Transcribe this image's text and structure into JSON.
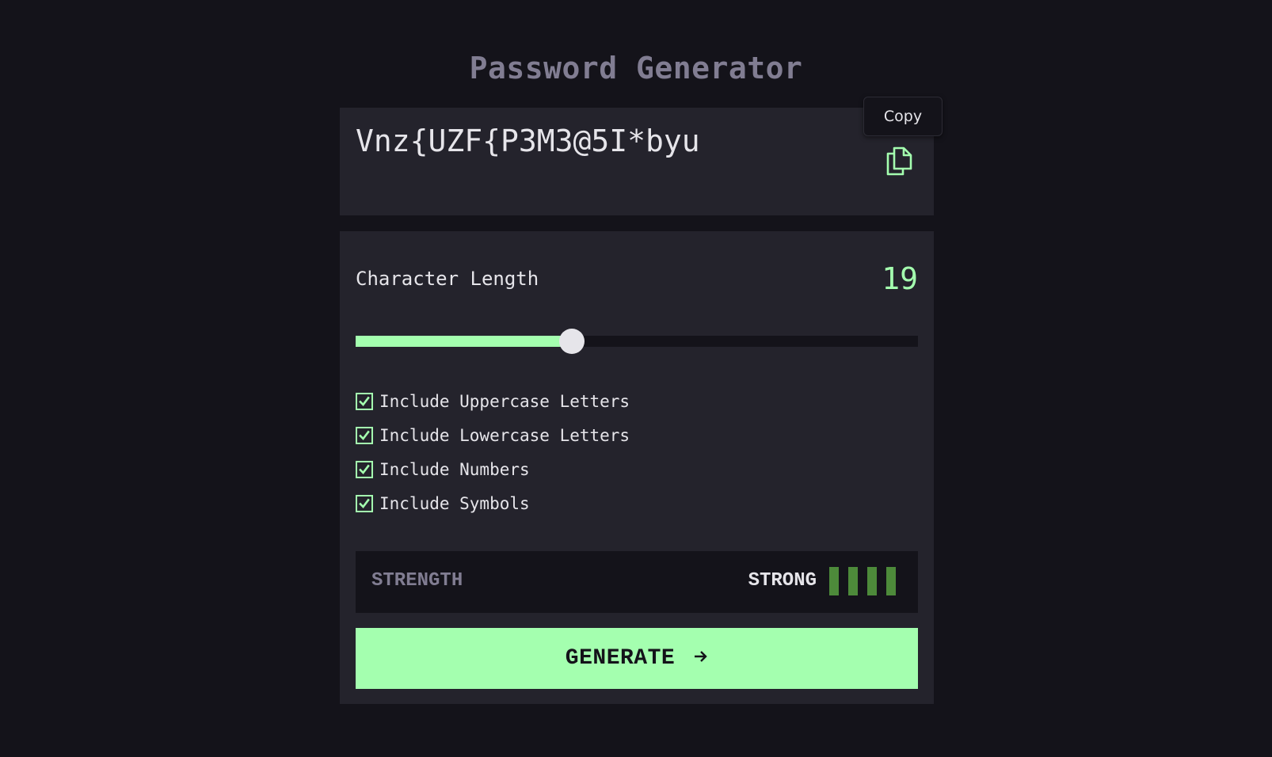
{
  "app": {
    "title": "Password Generator"
  },
  "password": {
    "value": "Vnz{UZF{P3M3@5I*byu",
    "copy_tooltip": "Copy",
    "copy_icon": "copy-icon"
  },
  "length": {
    "label": "Character Length",
    "value": "19",
    "min": 0,
    "max": 50,
    "fraction": 0.385
  },
  "options": [
    {
      "label": "Include Uppercase Letters",
      "checked": true
    },
    {
      "label": "Include Lowercase Letters",
      "checked": true
    },
    {
      "label": "Include Numbers",
      "checked": true
    },
    {
      "label": "Include Symbols",
      "checked": true
    }
  ],
  "strength": {
    "label": "STRENGTH",
    "value": "STRONG",
    "bars_filled": 4,
    "bars_total": 4
  },
  "generate": {
    "label": "GENERATE",
    "icon": "arrow-right-icon"
  },
  "colors": {
    "background": "#14131a",
    "panel": "#24232c",
    "accent": "#a4ffaf",
    "muted": "#817d92",
    "text": "#e6e5ea",
    "strength_bar": "#4d8a3a"
  }
}
